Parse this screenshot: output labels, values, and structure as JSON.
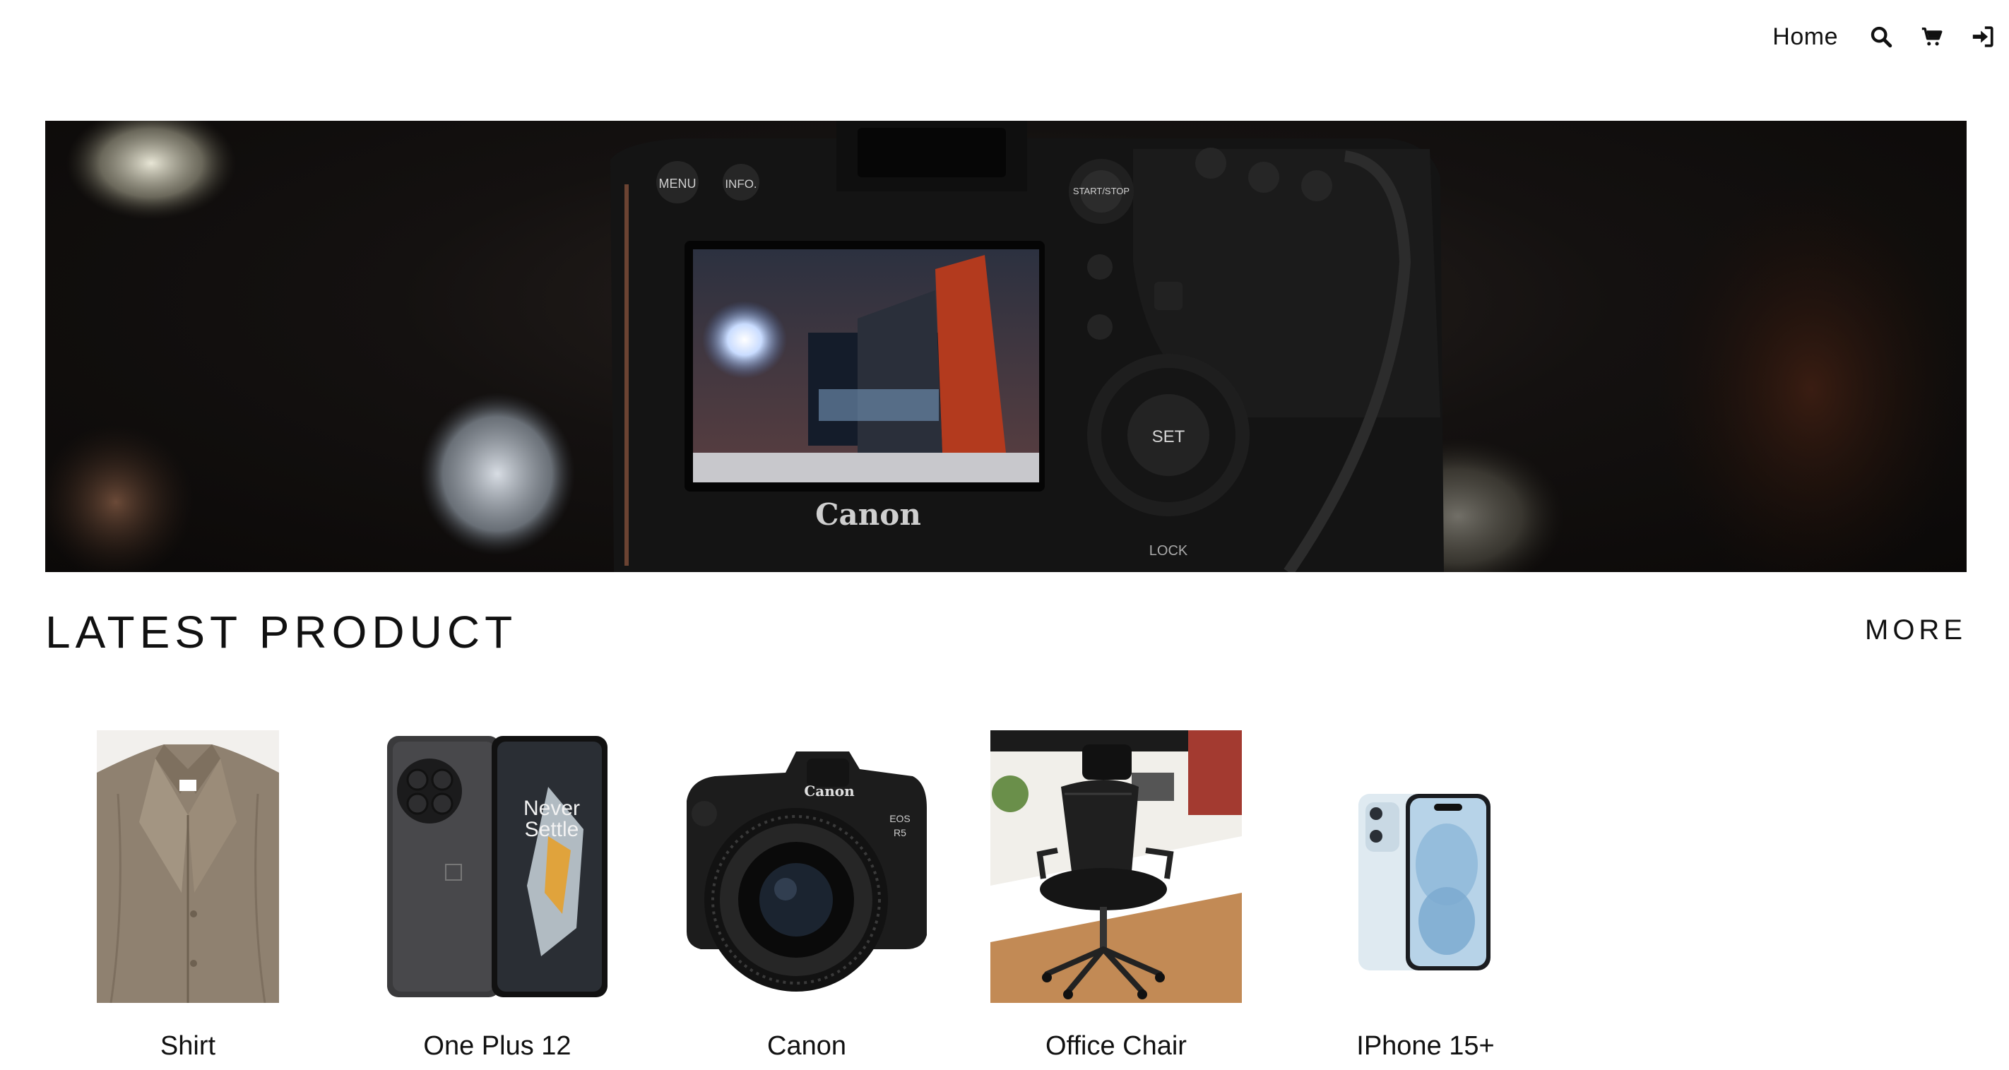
{
  "nav": {
    "home_label": "Home",
    "icons": [
      "search-icon",
      "cart-icon",
      "sign-in-icon"
    ]
  },
  "hero": {
    "brand_text": "Canon",
    "camera_buttons": [
      "MENU",
      "INFO.",
      "START/STOP",
      "SET",
      "LOCK"
    ]
  },
  "section": {
    "title": "LATEST PRODUCT",
    "more_label": "MORE"
  },
  "products": [
    {
      "name": "Shirt"
    },
    {
      "name": "One Plus 12"
    },
    {
      "name": "Canon"
    },
    {
      "name": "Office Chair"
    },
    {
      "name": "IPhone 15+"
    }
  ],
  "colors": {
    "text": "#111111",
    "background": "#ffffff",
    "shirt": "#8f8170",
    "phone_dark": "#3a3a3c",
    "iphone_blue": "#a9cbe3"
  }
}
